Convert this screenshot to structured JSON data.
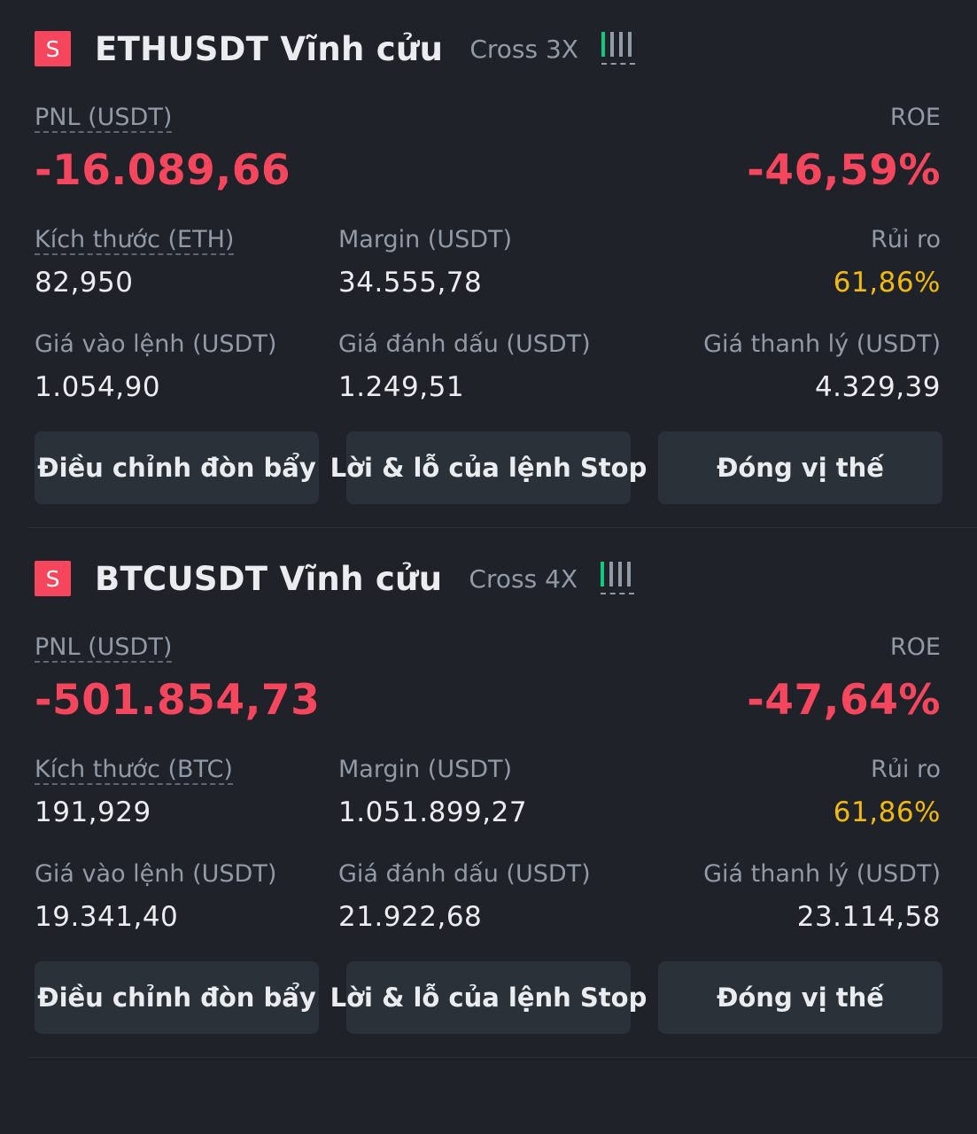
{
  "positions": [
    {
      "side_badge": "S",
      "symbol": "ETHUSDT Vĩnh cửu",
      "margin_mode": "Cross 3X",
      "pnl_label": "PNL (USDT)",
      "pnl_value": "-16.089,66",
      "roe_label": "ROE",
      "roe_value": "-46,59%",
      "size_label": "Kích thước (ETH)",
      "size_value": "82,950",
      "margin_label": "Margin (USDT)",
      "margin_value": "34.555,78",
      "risk_label": "Rủi ro",
      "risk_value": "61,86%",
      "entry_label": "Giá vào lệnh (USDT)",
      "entry_value": "1.054,90",
      "mark_label": "Giá đánh dấu (USDT)",
      "mark_value": "1.249,51",
      "liq_label": "Giá thanh lý (USDT)",
      "liq_value": "4.329,39",
      "btn_leverage": "Điều chỉnh đòn bẩy",
      "btn_tpsl": "Lời & lỗ của lệnh Stop",
      "btn_close": "Đóng vị thế"
    },
    {
      "side_badge": "S",
      "symbol": "BTCUSDT Vĩnh cửu",
      "margin_mode": "Cross 4X",
      "pnl_label": "PNL (USDT)",
      "pnl_value": "-501.854,73",
      "roe_label": "ROE",
      "roe_value": "-47,64%",
      "size_label": "Kích thước (BTC)",
      "size_value": "191,929",
      "margin_label": "Margin (USDT)",
      "margin_value": "1.051.899,27",
      "risk_label": "Rủi ro",
      "risk_value": "61,86%",
      "entry_label": "Giá vào lệnh (USDT)",
      "entry_value": "19.341,40",
      "mark_label": "Giá đánh dấu (USDT)",
      "mark_value": "21.922,68",
      "liq_label": "Giá thanh lý (USDT)",
      "liq_value": "23.114,58",
      "btn_leverage": "Điều chỉnh đòn bẩy",
      "btn_tpsl": "Lời & lỗ của lệnh Stop",
      "btn_close": "Đóng vị thế"
    }
  ],
  "risk_indicator": {
    "icon": "signal-strength-icon",
    "active_bars": 1,
    "total_bars": 4
  },
  "colors": {
    "background": "#1f2229",
    "loss": "#f6465d",
    "gain": "#0ecb81",
    "warning": "#f0b90b",
    "button_bg": "#2b3139",
    "muted_text": "#929aa5",
    "primary_text": "#eaecef"
  }
}
